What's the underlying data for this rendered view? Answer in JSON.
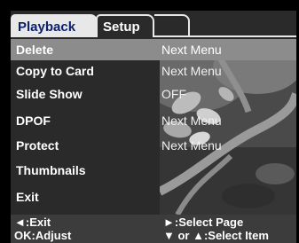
{
  "tabs": [
    {
      "label": "Playback",
      "active": true
    },
    {
      "label": "Setup",
      "active": false
    }
  ],
  "menu": {
    "items": [
      {
        "label": "Delete",
        "value": "Next Menu",
        "selected": true
      },
      {
        "label": "Copy to Card",
        "value": "Next Menu",
        "selected": false
      },
      {
        "label": "Slide Show",
        "value": "OFF",
        "selected": false
      },
      {
        "label": "DPOF",
        "value": "Next Menu",
        "selected": false
      },
      {
        "label": "Protect",
        "value": "Next Menu",
        "selected": false
      },
      {
        "label": "Thumbnails",
        "value": "",
        "selected": false
      },
      {
        "label": "Exit",
        "value": "",
        "selected": false
      }
    ]
  },
  "footer": {
    "exit_hint": "◄:Exit",
    "adjust_hint": "OK:Adjust",
    "select_page_hint": "►:Select Page",
    "select_item_hint": "▼ or ▲:Select Item"
  },
  "colors": {
    "background": "#2a2a2a",
    "active_tab": "#e8e8e8",
    "active_tab_text": "#0a1e6a",
    "selected_row": "#8c8c8c",
    "footer": "#3c3c3c"
  }
}
